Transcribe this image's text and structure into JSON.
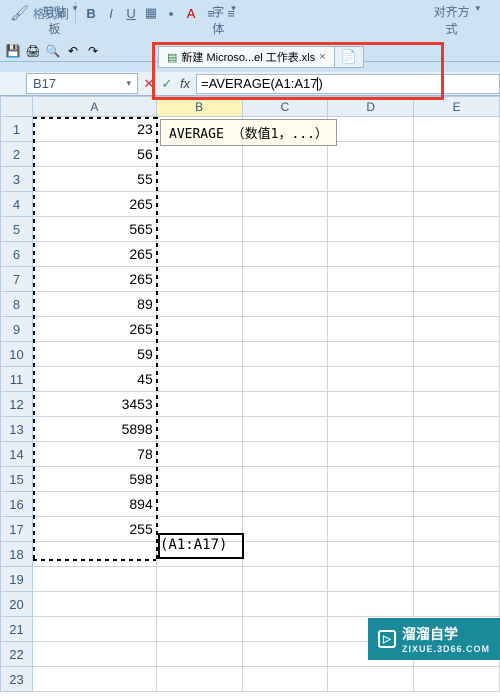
{
  "ribbon": {
    "format_brush": "格式刷",
    "clipboard_label": "剪贴板",
    "font_label": "字体",
    "align_label": "对齐方式"
  },
  "tab": {
    "name": "新建 Microso...el 工作表.xls",
    "close": "×"
  },
  "namebox": {
    "value": "B17"
  },
  "formula": {
    "fx": "fx",
    "value": "=AVERAGE(A1:A17"
  },
  "tooltip": {
    "text": "AVERAGE （数值1，...）"
  },
  "columns": [
    "A",
    "B",
    "C",
    "D",
    "E"
  ],
  "rows": [
    {
      "n": 1,
      "A": "23"
    },
    {
      "n": 2,
      "A": "56"
    },
    {
      "n": 3,
      "A": "55"
    },
    {
      "n": 4,
      "A": "265"
    },
    {
      "n": 5,
      "A": "565"
    },
    {
      "n": 6,
      "A": "265"
    },
    {
      "n": 7,
      "A": "265"
    },
    {
      "n": 8,
      "A": "89"
    },
    {
      "n": 9,
      "A": "265"
    },
    {
      "n": 10,
      "A": "59"
    },
    {
      "n": 11,
      "A": "45"
    },
    {
      "n": 12,
      "A": "3453"
    },
    {
      "n": 13,
      "A": "5898"
    },
    {
      "n": 14,
      "A": "78"
    },
    {
      "n": 15,
      "A": "598"
    },
    {
      "n": 16,
      "A": "894"
    },
    {
      "n": 17,
      "A": "255"
    },
    {
      "n": 18,
      "A": ""
    },
    {
      "n": 19,
      "A": ""
    },
    {
      "n": 20,
      "A": ""
    },
    {
      "n": 21,
      "A": ""
    },
    {
      "n": 22,
      "A": ""
    },
    {
      "n": 23,
      "A": ""
    }
  ],
  "ref_label": "(A1:A17)",
  "watermark": {
    "main": "溜溜自学",
    "sub": "ZIXUE.3D66.COM",
    "icon": "▷"
  }
}
